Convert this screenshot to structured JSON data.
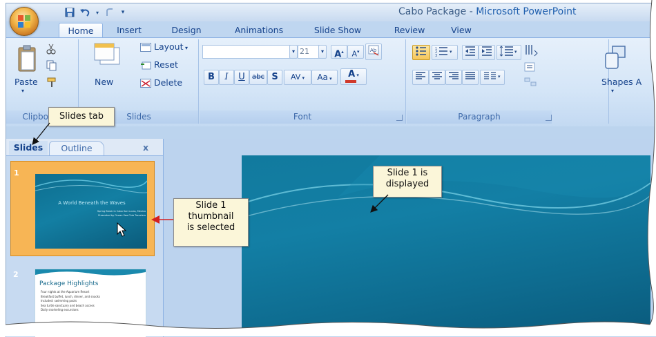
{
  "window": {
    "title_doc": "Cabo Package",
    "title_sep": " - ",
    "title_app": "Microsoft PowerPoint"
  },
  "tabs": [
    "Home",
    "Insert",
    "Design",
    "Animations",
    "Slide Show",
    "Review",
    "View"
  ],
  "ribbon": {
    "clipboard": {
      "label": "Clipboard",
      "paste": "Paste"
    },
    "slides": {
      "label": "Slides",
      "new": "New",
      "layout": "Layout",
      "reset": "Reset",
      "delete": "Delete"
    },
    "font": {
      "label": "Font",
      "size": "21",
      "bold": "B",
      "italic": "I",
      "underline": "U",
      "strike": "abc",
      "shadow": "S",
      "spacing": "AV",
      "case": "Aa",
      "color": "A",
      "grow": "A",
      "shrink": "A"
    },
    "paragraph": {
      "label": "Paragraph"
    },
    "drawing": {
      "shapes": "Shapes",
      "arrange": "A"
    }
  },
  "left_pane": {
    "tabs": [
      "Slides",
      "Outline"
    ],
    "close": "x",
    "thumbnails": [
      {
        "number": "1",
        "title": "A World Beneath the Waves",
        "subtitle": "Spring Break in Cabo San Lucas, Mexico",
        "subtitle2": "Presented by Ocean Sea Club Travelers"
      },
      {
        "number": "2",
        "title": "Package Highlights",
        "bullets": [
          "Four nights at the Aquarium Resort",
          "Breakfast buffet, lunch, dinner, and snacks",
          "Included: swimming pools",
          "Sea turtle sanctuary and beach access",
          "Daily snorkeling excursions"
        ]
      }
    ]
  },
  "callouts": {
    "slides_tab": "Slides tab",
    "thumbnail": [
      "Slide 1",
      "thumbnail",
      "is selected"
    ],
    "displayed": [
      "Slide 1 is",
      "displayed"
    ]
  },
  "colors": {
    "ribbon": "#d4e5f7",
    "tab_text": "#15428b",
    "slide_teal": "#117a9e",
    "thumb_selected": "#f7b555",
    "callout_bg": "#fbf6d9",
    "callout_line": "#d42020"
  }
}
